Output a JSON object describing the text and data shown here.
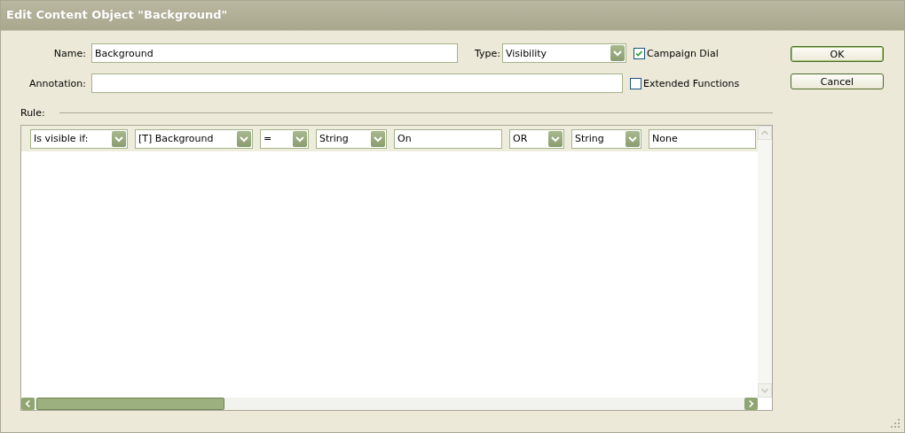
{
  "window": {
    "title": "Edit Content Object \"Background\""
  },
  "name_field": {
    "label": "Name:",
    "value": "Background"
  },
  "type_field": {
    "label": "Type:",
    "value": "Visibility"
  },
  "annotation_field": {
    "label": "Annotation:"
  },
  "checkboxes": [
    {
      "label": "Campaign Dial",
      "checked": true
    },
    {
      "label": "Extended Functions",
      "checked": false
    }
  ],
  "buttons": [
    {
      "label": "OK",
      "default": true
    },
    {
      "label": "Cancel",
      "default": false
    }
  ],
  "rule": {
    "label": "Rule:",
    "controls": [
      {
        "kind": "dropdown",
        "value": "Is visible if:"
      },
      {
        "kind": "dropdown",
        "value": "[T] Background"
      },
      {
        "kind": "dropdown",
        "value": "="
      },
      {
        "kind": "dropdown",
        "value": "String"
      },
      {
        "kind": "input",
        "value": "On"
      },
      {
        "kind": "dropdown",
        "value": "OR"
      },
      {
        "kind": "dropdown",
        "value": "String"
      },
      {
        "kind": "input",
        "value": "None"
      }
    ]
  }
}
